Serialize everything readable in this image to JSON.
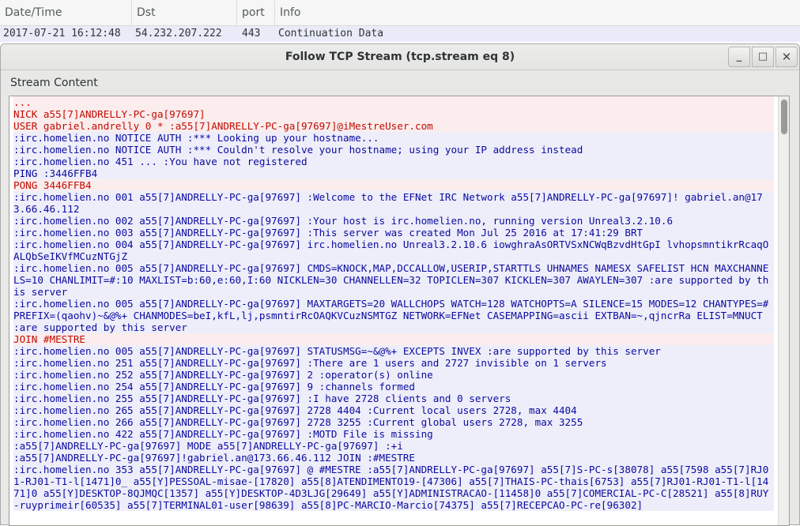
{
  "packet_list": {
    "columns": [
      "Date/Time",
      "Dst",
      "port",
      "Info"
    ],
    "row": {
      "datetime": "2017-07-21 16:12:48",
      "dst": "54.232.207.222",
      "port": "443",
      "info": "Continuation Data"
    }
  },
  "dialog": {
    "title": "Follow TCP Stream (tcp.stream eq 8)",
    "buttons": {
      "minimize": "_",
      "maximize": "□",
      "close": "✕"
    },
    "section_label": "Stream Content"
  },
  "colors": {
    "client_text": "#c20b00",
    "client_bg": "#fbeded",
    "server_text": "#0a0a9e",
    "server_bg": "#eeeefb",
    "selected_row_bg": "#e9ebf8"
  },
  "stream_lines": [
    {
      "dir": "client",
      "text": "..."
    },
    {
      "dir": "client",
      "text": "NICK a55[7]ANDRELLY-PC-ga[97697]"
    },
    {
      "dir": "client",
      "text": "USER gabriel.andrelly 0 * :a55[7]ANDRELLY-PC-ga[97697]@iMestreUser.com"
    },
    {
      "dir": "server",
      "text": ":irc.homelien.no NOTICE AUTH :*** Looking up your hostname..."
    },
    {
      "dir": "server",
      "text": ":irc.homelien.no NOTICE AUTH :*** Couldn't resolve your hostname; using your IP address instead"
    },
    {
      "dir": "server",
      "text": ":irc.homelien.no 451 ... :You have not registered"
    },
    {
      "dir": "server",
      "text": "PING :3446FFB4"
    },
    {
      "dir": "client",
      "text": "PONG 3446FFB4"
    },
    {
      "dir": "server",
      "text": ":irc.homelien.no 001 a55[7]ANDRELLY-PC-ga[97697] :Welcome to the EFNet IRC Network a55[7]ANDRELLY-PC-ga[97697]! gabriel.an@173.66.46.112"
    },
    {
      "dir": "server",
      "text": ":irc.homelien.no 002 a55[7]ANDRELLY-PC-ga[97697] :Your host is irc.homelien.no, running version Unreal3.2.10.6"
    },
    {
      "dir": "server",
      "text": ":irc.homelien.no 003 a55[7]ANDRELLY-PC-ga[97697] :This server was created Mon Jul 25 2016 at 17:41:29 BRT"
    },
    {
      "dir": "server",
      "text": ":irc.homelien.no 004 a55[7]ANDRELLY-PC-ga[97697] irc.homelien.no Unreal3.2.10.6 iowghraAsORTVSxNCWqBzvdHtGpI lvhopsmntikrRcaqOALQbSeIKVfMCuzNTGjZ"
    },
    {
      "dir": "server",
      "text": ":irc.homelien.no 005 a55[7]ANDRELLY-PC-ga[97697] CMDS=KNOCK,MAP,DCCALLOW,USERIP,STARTTLS UHNAMES NAMESX SAFELIST HCN MAXCHANNELS=10 CHANLIMIT=#:10 MAXLIST=b:60,e:60,I:60 NICKLEN=30 CHANNELLEN=32 TOPICLEN=307 KICKLEN=307 AWAYLEN=307 :are supported by this server"
    },
    {
      "dir": "server",
      "text": ":irc.homelien.no 005 a55[7]ANDRELLY-PC-ga[97697] MAXTARGETS=20 WALLCHOPS WATCH=128 WATCHOPTS=A SILENCE=15 MODES=12 CHANTYPES=# PREFIX=(qaohv)~&@%+ CHANMODES=beI,kfL,lj,psmntirRcOAQKVCuzNSMTGZ NETWORK=EFNet CASEMAPPING=ascii EXTBAN=~,qjncrRa ELIST=MNUCT :are supported by this server"
    },
    {
      "dir": "client",
      "text": "JOIN #MESTRE"
    },
    {
      "dir": "server",
      "text": ":irc.homelien.no 005 a55[7]ANDRELLY-PC-ga[97697] STATUSMSG=~&@%+ EXCEPTS INVEX :are supported by this server"
    },
    {
      "dir": "server",
      "text": ":irc.homelien.no 251 a55[7]ANDRELLY-PC-ga[97697] :There are 1 users and 2727 invisible on 1 servers"
    },
    {
      "dir": "server",
      "text": ":irc.homelien.no 252 a55[7]ANDRELLY-PC-ga[97697] 2 :operator(s) online"
    },
    {
      "dir": "server",
      "text": ":irc.homelien.no 254 a55[7]ANDRELLY-PC-ga[97697] 9 :channels formed"
    },
    {
      "dir": "server",
      "text": ":irc.homelien.no 255 a55[7]ANDRELLY-PC-ga[97697] :I have 2728 clients and 0 servers"
    },
    {
      "dir": "server",
      "text": ":irc.homelien.no 265 a55[7]ANDRELLY-PC-ga[97697] 2728 4404 :Current local users 2728, max 4404"
    },
    {
      "dir": "server",
      "text": ":irc.homelien.no 266 a55[7]ANDRELLY-PC-ga[97697] 2728 3255 :Current global users 2728, max 3255"
    },
    {
      "dir": "server",
      "text": ":irc.homelien.no 422 a55[7]ANDRELLY-PC-ga[97697] :MOTD File is missing"
    },
    {
      "dir": "server",
      "text": ":a55[7]ANDRELLY-PC-ga[97697] MODE a55[7]ANDRELLY-PC-ga[97697] :+i"
    },
    {
      "dir": "server",
      "text": ":a55[7]ANDRELLY-PC-ga[97697]!gabriel.an@173.66.46.112 JOIN :#MESTRE"
    },
    {
      "dir": "server",
      "text": ":irc.homelien.no 353 a55[7]ANDRELLY-PC-ga[97697] @ #MESTRE :a55[7]ANDRELLY-PC-ga[97697] a55[7]S-PC-s[38078] a55[7598 a55[7]RJ01-RJ01-T1-l[1471]0_ a55[Y]PESSOAL-misae-[17820] a55[8]ATENDIMENTO19-[47306] a55[7]THAIS-PC-thais[6753] a55[7]RJ01-RJ01-T1-l[1471]0 a55[Y]DESKTOP-8QJMQC[1357] a55[Y]DESKTOP-4D3LJG[29649] a55[Y]ADMINISTRACAO-[11458]0 a55[7]COMERCIAL-PC-C[28521] a55[8]RUY-ruyprimeir[60535] a55[7]TERMINAL01-user[98639] a55[8]PC-MARCIO-Marcio[74375] a55[7]RECEPCAO-PC-re[96302]"
    }
  ]
}
